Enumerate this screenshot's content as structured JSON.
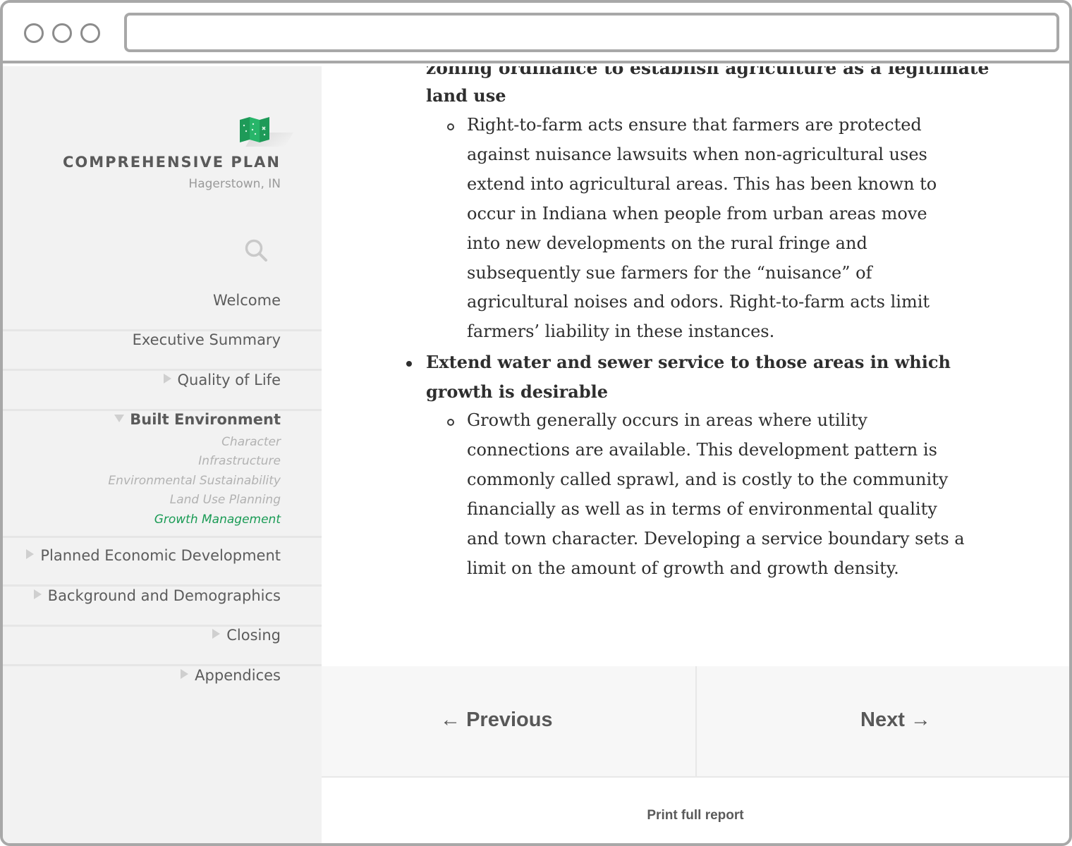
{
  "window": {
    "url": ""
  },
  "sidebar": {
    "title": "COMPREHENSIVE PLAN",
    "subtitle": "Hagerstown, IN",
    "logo_icon": "folded-map-icon",
    "accent_color": "#1a9b55",
    "nav": [
      {
        "label": "Welcome",
        "has_arrow": false
      },
      {
        "label": "Executive Summary",
        "has_arrow": false
      },
      {
        "label": "Quality of Life",
        "has_arrow": true
      },
      {
        "label": "Built Environment",
        "expanded": true
      },
      {
        "label": "Planned Economic Development",
        "has_arrow": true
      },
      {
        "label": "Background and Demographics",
        "has_arrow": true
      },
      {
        "label": "Closing",
        "has_arrow": true
      },
      {
        "label": "Appendices",
        "has_arrow": true
      }
    ],
    "sub_nav": [
      {
        "label": "Character",
        "active": false
      },
      {
        "label": "Infrastructure",
        "active": false
      },
      {
        "label": "Environmental Sustainability",
        "active": false
      },
      {
        "label": "Land Use Planning",
        "active": false
      },
      {
        "label": "Growth Management",
        "active": true
      }
    ]
  },
  "content": {
    "clipped_heading_top": "zoning ordinance to establish agriculture as a legitimate",
    "clipped_heading_bottom": "land use",
    "right_to_farm": "Right-to-farm acts ensure that farmers are protected against nuisance lawsuits when non-agricultural uses extend into agricultural areas. This has been known to occur in Indiana when people from urban areas move into new developments on the rural fringe and subsequently sue farmers for the “nuisance” of agricultural noises and odors. Right-to-farm acts limit farmers’ liability in these instances.",
    "heading_line1": "Extend water and sewer service to those areas in which",
    "heading_line2": "growth is desirable",
    "growth_para": "Growth generally occurs in areas where utility connections are available. This development pattern is commonly called sprawl, and is costly to the community financially as well as in terms of environmental quality and town character. Developing a service boundary sets a limit on the amount of growth and growth density."
  },
  "pager": {
    "previous": "Previous",
    "next": "Next"
  },
  "footer": {
    "print": "Print full report"
  }
}
